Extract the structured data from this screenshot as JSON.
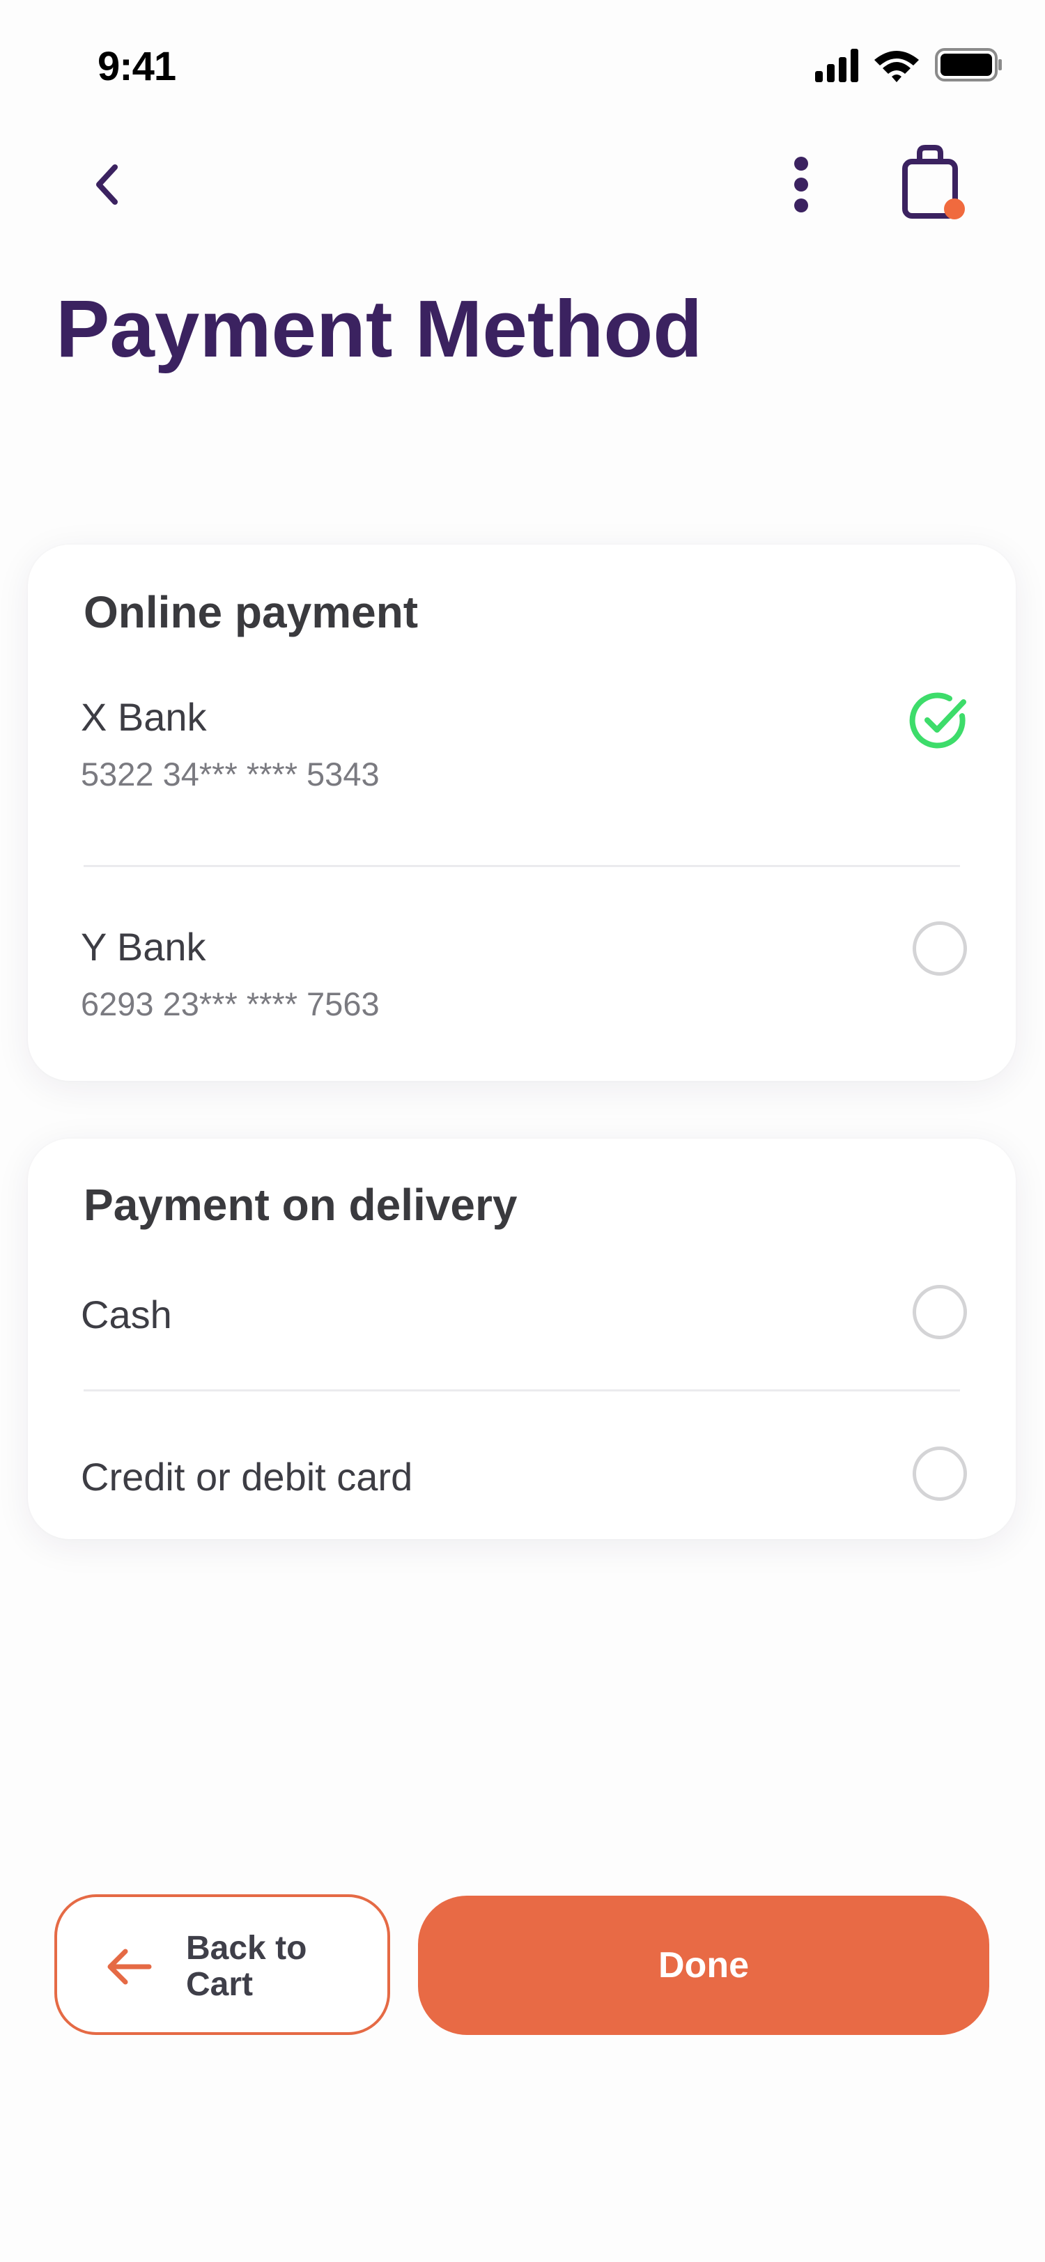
{
  "status_bar": {
    "time": "9:41"
  },
  "header": {
    "title": "Payment Method"
  },
  "online": {
    "title": "Online payment",
    "options": [
      {
        "name": "X Bank",
        "number": "5322 34*** **** 5343",
        "selected": true
      },
      {
        "name": "Y Bank",
        "number": "6293 23*** **** 7563",
        "selected": false
      }
    ]
  },
  "delivery": {
    "title": "Payment on delivery",
    "options": [
      {
        "name": "Cash",
        "selected": false
      },
      {
        "name": "Credit or debit card",
        "selected": false
      }
    ]
  },
  "buttons": {
    "back_line1": "Back to",
    "back_line2": "Cart",
    "done": "Done"
  },
  "colors": {
    "accent": "#e86a45",
    "title": "#3b2260",
    "check": "#3ddc6a",
    "notification_dot": "#f06a3e"
  }
}
